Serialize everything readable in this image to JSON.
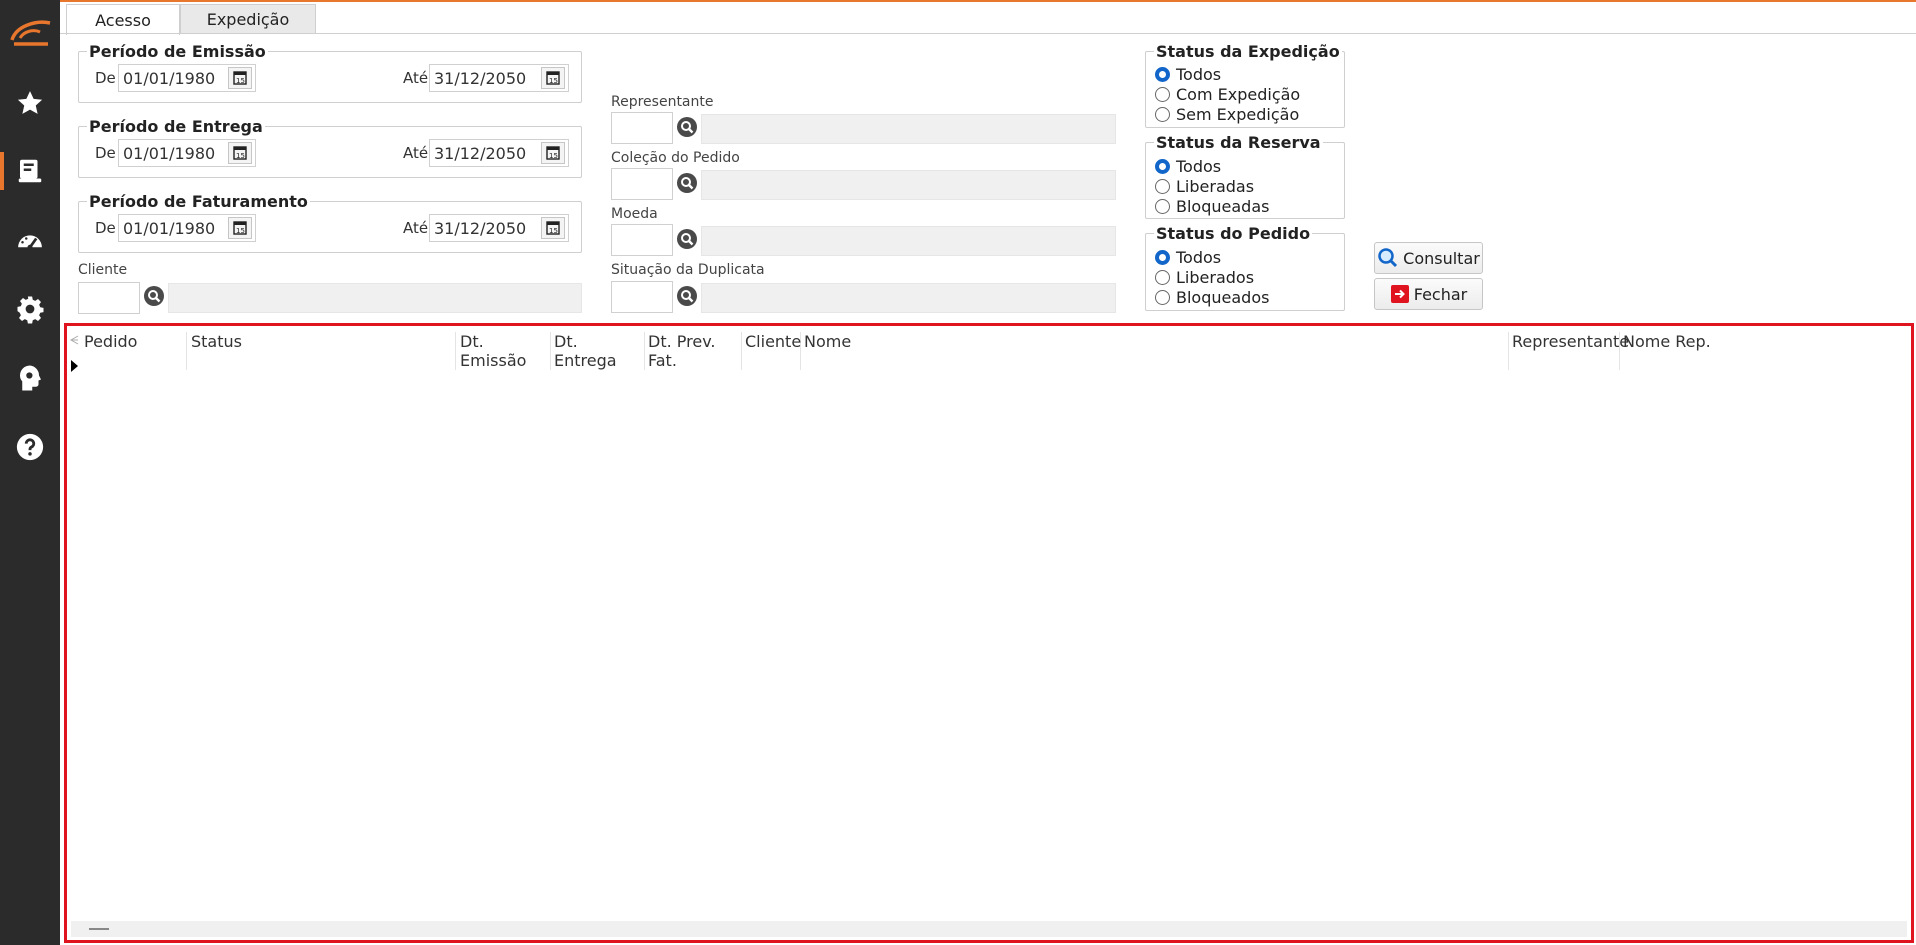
{
  "colors": {
    "accent": "#e8762d",
    "sidebar_bg": "#2b2b2b",
    "radio_selected": "#1266c9",
    "grid_border": "#e0141f"
  },
  "sidebar": {
    "logo": "brand-logo",
    "items": [
      {
        "icon": "star-icon"
      },
      {
        "icon": "book-icon",
        "active": true
      },
      {
        "icon": "speedometer-icon"
      },
      {
        "icon": "gear-icon"
      },
      {
        "icon": "brain-head-icon"
      },
      {
        "icon": "help-icon"
      }
    ]
  },
  "tabs": [
    {
      "label": "Acesso",
      "active": true
    },
    {
      "label": "Expedição",
      "active": false
    }
  ],
  "periods": {
    "emissao": {
      "title": "Período de Emissão",
      "de_label": "De",
      "de": "01/01/1980",
      "ate_label": "Até",
      "ate": "31/12/2050"
    },
    "entrega": {
      "title": "Período de Entrega",
      "de_label": "De",
      "de": "01/01/1980",
      "ate_label": "Até",
      "ate": "31/12/2050"
    },
    "faturamento": {
      "title": "Período de Faturamento",
      "de_label": "De",
      "de": "01/01/1980",
      "ate_label": "Até",
      "ate": "31/12/2050"
    }
  },
  "lookups": {
    "cliente": {
      "label": "Cliente",
      "code": "",
      "desc": ""
    },
    "representante": {
      "label": "Representante",
      "code": "",
      "desc": ""
    },
    "colecao": {
      "label": "Coleção do Pedido",
      "code": "",
      "desc": ""
    },
    "moeda": {
      "label": "Moeda",
      "code": "",
      "desc": ""
    },
    "situacao": {
      "label": "Situação da Duplicata",
      "code": "",
      "desc": ""
    }
  },
  "status_expedicao": {
    "title": "Status da Expedição",
    "options": [
      "Todos",
      "Com Expedição",
      "Sem Expedição"
    ],
    "selected": "Todos"
  },
  "status_reserva": {
    "title": "Status da Reserva",
    "options": [
      "Todos",
      "Liberadas",
      "Bloqueadas"
    ],
    "selected": "Todos"
  },
  "status_pedido": {
    "title": "Status do Pedido",
    "options": [
      "Todos",
      "Liberados",
      "Bloqueados"
    ],
    "selected": "Todos"
  },
  "buttons": {
    "consultar": "Consultar",
    "fechar": "Fechar"
  },
  "grid": {
    "columns": [
      "Pedido",
      "Status",
      "Dt. Emissão",
      "Dt. Entrega",
      "Dt. Prev. Fat.",
      "Cliente",
      "Nome",
      "Representante",
      "Nome Rep."
    ],
    "rows": []
  }
}
